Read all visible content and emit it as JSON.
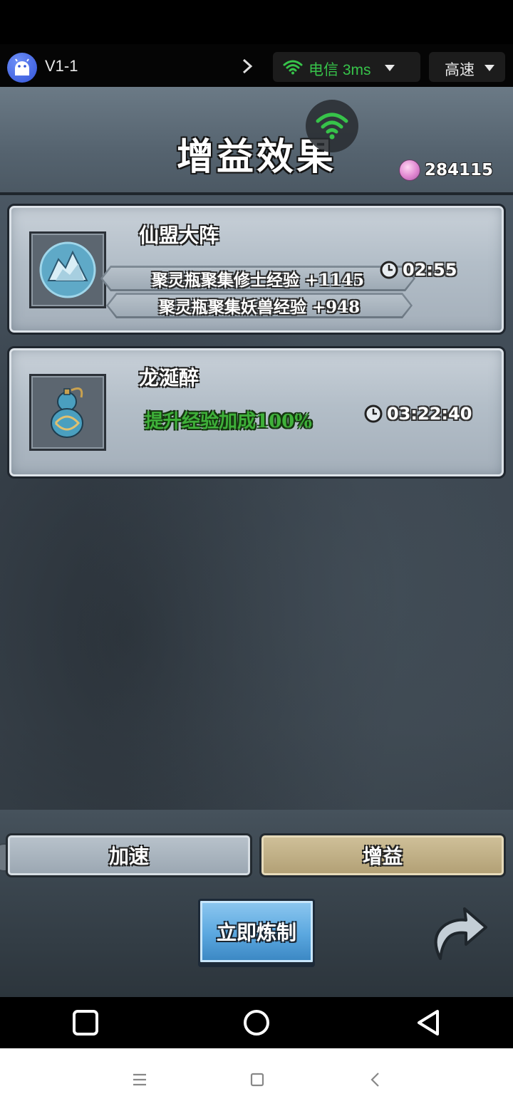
{
  "toolbar": {
    "device_name": "V1-1",
    "network_label": "电信 3ms",
    "speed_label": "高速",
    "accent_green": "#37c34a"
  },
  "game": {
    "title": "增益效果",
    "currency_value": "284115",
    "buffs": [
      {
        "name": "仙盟大阵",
        "icon": "mountain-orb-icon",
        "effects": [
          "聚灵瓶聚集修士经验 +1145",
          "聚灵瓶聚集妖兽经验 +948"
        ],
        "timer": "02:55"
      },
      {
        "name": "龙涎醉",
        "icon": "gourd-icon",
        "effects": [
          "提升经验加成100%"
        ],
        "timer": "03:22:40"
      }
    ],
    "tabs": {
      "speed": "加速",
      "buff": "增益"
    },
    "refine_button": "立即炼制"
  }
}
